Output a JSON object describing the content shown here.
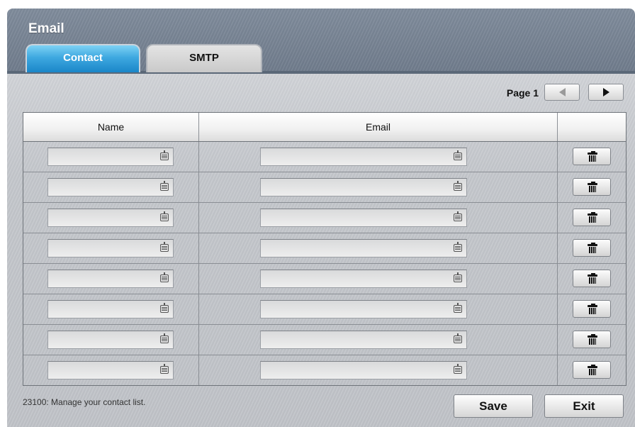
{
  "window": {
    "title": "Email"
  },
  "tabs": [
    {
      "label": "Contact",
      "active": true
    },
    {
      "label": "SMTP",
      "active": false
    }
  ],
  "pager": {
    "label": "Page 1"
  },
  "table": {
    "headers": {
      "name": "Name",
      "email": "Email",
      "actions": ""
    },
    "rows": [
      {
        "name": "",
        "email": ""
      },
      {
        "name": "",
        "email": ""
      },
      {
        "name": "",
        "email": ""
      },
      {
        "name": "",
        "email": ""
      },
      {
        "name": "",
        "email": ""
      },
      {
        "name": "",
        "email": ""
      },
      {
        "name": "",
        "email": ""
      },
      {
        "name": "",
        "email": ""
      }
    ]
  },
  "status": {
    "text": "23100: Manage your contact list."
  },
  "buttons": {
    "save": "Save",
    "exit": "Exit"
  },
  "icons": {
    "name_field": "keyboard-icon",
    "email_field": "keyboard-icon",
    "delete": "trash-icon",
    "prev": "triangle-left-icon",
    "next": "triangle-right-icon"
  },
  "colors": {
    "active_tab": "#2a95d5",
    "header": "#7a8696"
  }
}
